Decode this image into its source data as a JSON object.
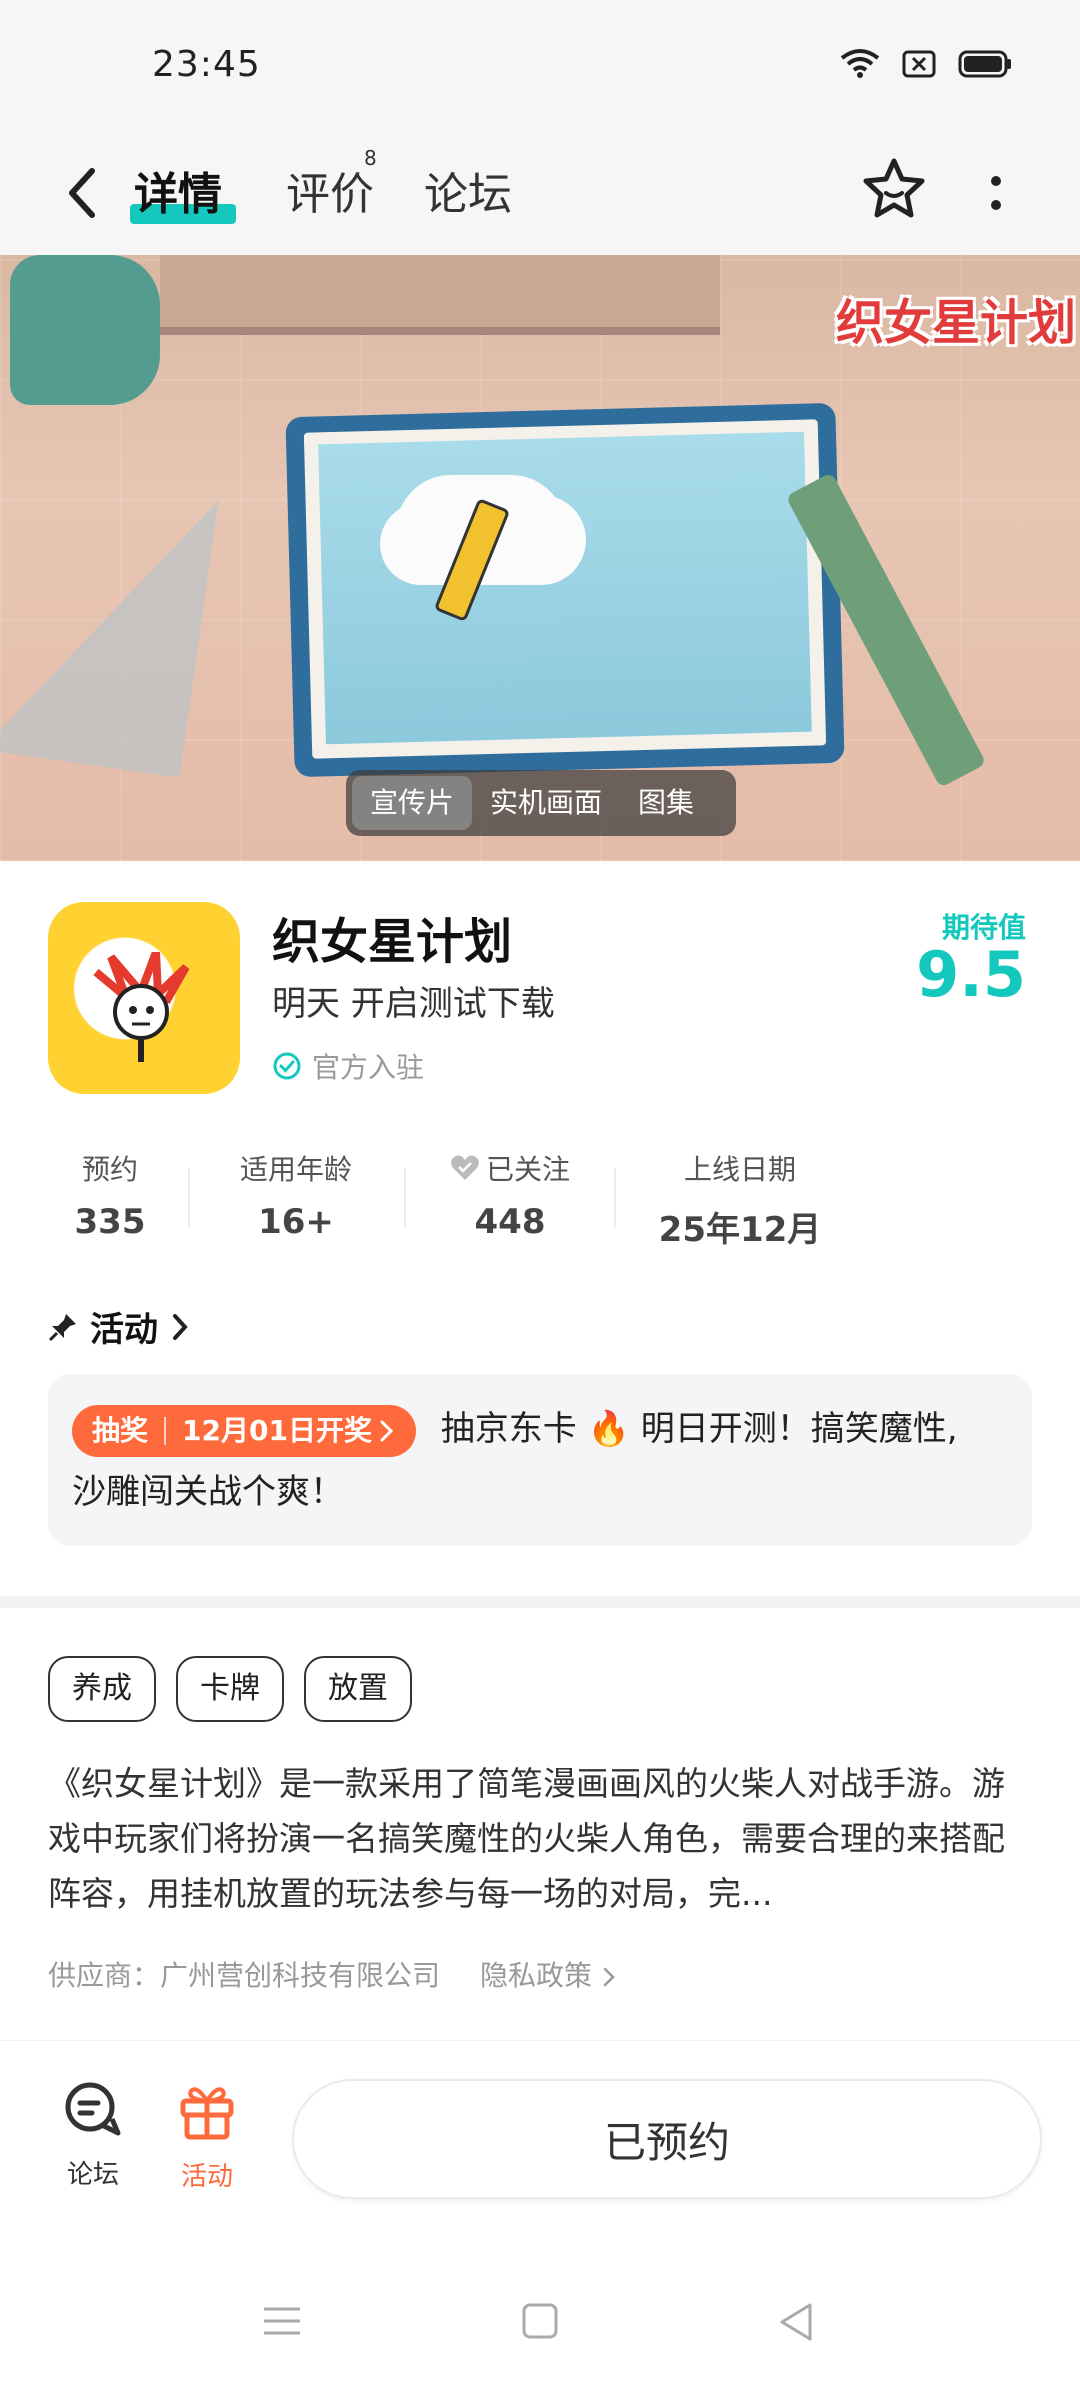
{
  "status_bar": {
    "time": "23:45"
  },
  "nav": {
    "tabs": [
      {
        "label": "详情"
      },
      {
        "label": "评价"
      },
      {
        "label": "论坛"
      }
    ],
    "review_badge": "8"
  },
  "hero": {
    "logo_text": "织女星计划",
    "media_tabs": [
      {
        "label": "宣传片"
      },
      {
        "label": "实机画面"
      },
      {
        "label": "图集"
      }
    ]
  },
  "app": {
    "title": "织女星计划",
    "subtitle": "明天 开启测试下载",
    "official_label": "官方入驻",
    "expect_label": "期待值",
    "expect_score": "9.5"
  },
  "stats": [
    {
      "label": "预约",
      "value": "335"
    },
    {
      "label": "适用年龄",
      "value": "16+"
    },
    {
      "label": "已关注",
      "value": "448"
    },
    {
      "label": "上线日期",
      "value": "25年12月"
    }
  ],
  "activity": {
    "header": "活动",
    "tag_type": "抽奖",
    "tag_date": "12月01日开奖",
    "text_line1": "抽京东卡 🔥 明日开测！搞笑魔性,",
    "text_line2": "沙雕闯关战个爽！"
  },
  "tags": [
    "养成",
    "卡牌",
    "放置"
  ],
  "description": "《织女星计划》是一款采用了简笔漫画画风的火柴人对战手游。游戏中玩家们将扮演一名搞笑魔性的火柴人角色，需要合理的来搭配阵容，用挂机放置的玩法参与每一场的对局，完...",
  "supplier": {
    "text": "供应商：广州营创科技有限公司",
    "privacy": "隐私政策"
  },
  "bottom_bar": {
    "forum_label": "论坛",
    "activity_label": "活动",
    "reserve_label": "已预约"
  },
  "colors": {
    "accent": "#14c8bd",
    "orange": "#ff6a3d"
  }
}
